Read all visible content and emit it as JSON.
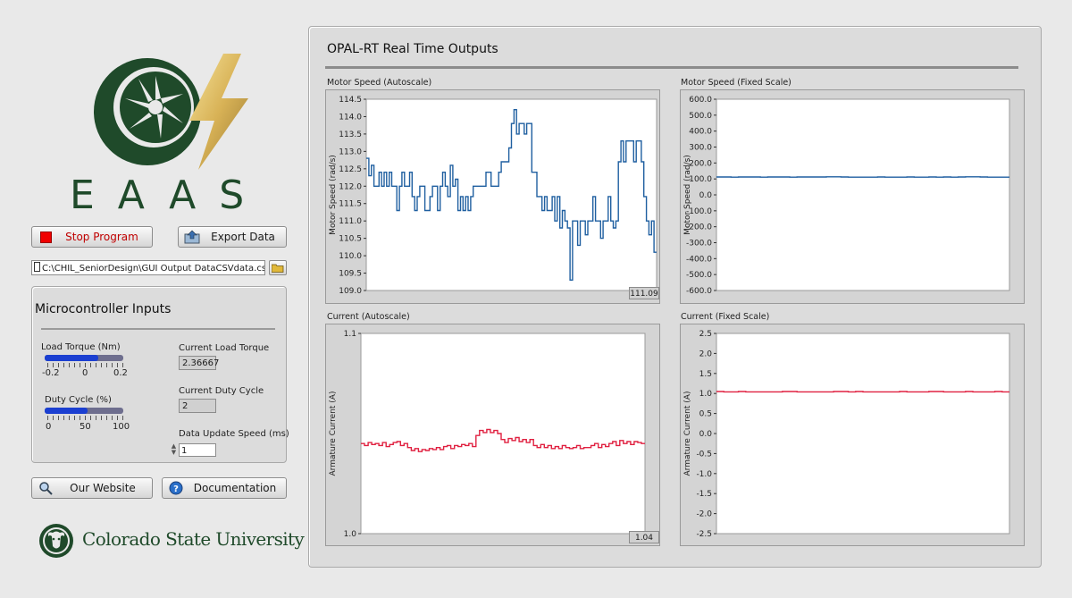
{
  "logo": {
    "text": "EAAS"
  },
  "buttons": {
    "stop": "Stop Program",
    "export": "Export Data",
    "website": "Our Website",
    "documentation": "Documentation"
  },
  "file_path": "C:\\CHIL_SeniorDesign\\GUI Output DataCSVdata.csv",
  "micro": {
    "title": "Microcontroller Inputs",
    "load_torque": {
      "label": "Load Torque (Nm)",
      "min_label": "-0.2",
      "mid_label": "0",
      "max_label": "0.2",
      "level": 0.68
    },
    "duty_cycle": {
      "label": "Duty Cycle (%)",
      "min_label": "0",
      "mid_label": "50",
      "max_label": "100",
      "level": 0.54
    },
    "current_load_torque": {
      "label": "Current Load Torque",
      "value": "2.36667"
    },
    "current_duty_cycle": {
      "label": "Current Duty Cycle",
      "value": "2"
    },
    "data_update_speed": {
      "label": "Data Update Speed (ms)",
      "value": "1"
    }
  },
  "university": "Colorado State University",
  "rt": {
    "title": "OPAL-RT Real Time Outputs"
  },
  "colors": {
    "speed": "#1f5fa0",
    "current": "#e02040"
  },
  "chart_data": [
    {
      "id": "speed_auto",
      "type": "line",
      "title": "Motor Speed (Autoscale)",
      "ylabel": "Motor Speed (rad/s)",
      "ylim": [
        109.0,
        114.5
      ],
      "yticks": [
        109.0,
        109.5,
        110.0,
        110.5,
        111.0,
        111.5,
        112.0,
        112.5,
        113.0,
        113.5,
        114.0,
        114.5
      ],
      "readout": "111.09",
      "color": "#1f5fa0",
      "values": [
        112.8,
        112.3,
        112.6,
        112.0,
        112.0,
        112.4,
        112.0,
        112.4,
        112.0,
        112.4,
        112.0,
        112.0,
        111.3,
        112.0,
        112.4,
        112.0,
        112.0,
        112.4,
        111.7,
        111.3,
        111.7,
        112.0,
        112.0,
        111.3,
        111.3,
        111.7,
        112.0,
        112.0,
        111.3,
        112.0,
        112.4,
        112.0,
        111.7,
        112.6,
        112.0,
        112.2,
        111.3,
        111.7,
        111.3,
        111.7,
        111.3,
        111.7,
        112.0,
        112.0,
        112.0,
        112.0,
        112.0,
        112.4,
        112.4,
        112.0,
        112.0,
        112.0,
        112.4,
        112.7,
        112.7,
        112.7,
        113.1,
        113.8,
        114.2,
        113.5,
        113.8,
        113.8,
        113.5,
        113.8,
        113.8,
        112.4,
        112.4,
        111.7,
        111.7,
        111.3,
        111.7,
        111.3,
        111.3,
        111.7,
        111.0,
        111.7,
        110.8,
        111.3,
        111.0,
        110.8,
        109.3,
        111.0,
        111.0,
        110.3,
        111.0,
        111.0,
        110.6,
        111.0,
        111.0,
        111.7,
        111.0,
        111.0,
        110.5,
        111.0,
        111.0,
        111.7,
        111.0,
        110.8,
        111.0,
        112.7,
        113.3,
        112.7,
        113.3,
        113.3,
        113.3,
        112.7,
        113.3,
        113.3,
        112.7,
        111.7,
        111.0,
        110.6,
        111.0,
        110.1
      ]
    },
    {
      "id": "speed_fixed",
      "type": "line",
      "title": "Motor Speed (Fixed Scale)",
      "ylabel": "Motor Speed (rad/s)",
      "ylim": [
        -600.0,
        600.0
      ],
      "yticks": [
        -600.0,
        -500.0,
        -400.0,
        -300.0,
        -200.0,
        -100.0,
        0.0,
        100.0,
        200.0,
        300.0,
        400.0,
        500.0,
        600.0
      ],
      "color": "#1f5fa0",
      "values": [
        112,
        112,
        111,
        112,
        112,
        112,
        111,
        112,
        112,
        112,
        111,
        112,
        112,
        112,
        112,
        113,
        113,
        112,
        111,
        111,
        111,
        111,
        112,
        111,
        111,
        111,
        112,
        111,
        111,
        112,
        111,
        112,
        111,
        112,
        113,
        113,
        112,
        111,
        111,
        111
      ]
    },
    {
      "id": "current_auto",
      "type": "line",
      "title": "Current (Autoscale)",
      "ylabel": "Armature Current (A)",
      "ylim": [
        1.0,
        1.1
      ],
      "yticks": [
        1.0,
        1.1
      ],
      "readout": "1.04",
      "color": "#e02040",
      "values": [
        1.045,
        1.044,
        1.0455,
        1.0445,
        1.045,
        1.044,
        1.0455,
        1.0435,
        1.0445,
        1.0455,
        1.046,
        1.044,
        1.045,
        1.043,
        1.0415,
        1.0425,
        1.041,
        1.042,
        1.0415,
        1.0425,
        1.042,
        1.043,
        1.042,
        1.0435,
        1.044,
        1.0425,
        1.044,
        1.0435,
        1.0445,
        1.044,
        1.045,
        1.0435,
        1.049,
        1.0515,
        1.0505,
        1.052,
        1.0505,
        1.0515,
        1.05,
        1.047,
        1.0455,
        1.0475,
        1.0465,
        1.048,
        1.046,
        1.047,
        1.0455,
        1.047,
        1.044,
        1.043,
        1.0445,
        1.043,
        1.044,
        1.0425,
        1.0435,
        1.0425,
        1.044,
        1.043,
        1.0425,
        1.043,
        1.044,
        1.0425,
        1.043,
        1.043,
        1.044,
        1.045,
        1.043,
        1.0445,
        1.0435,
        1.045,
        1.046,
        1.044,
        1.0465,
        1.045,
        1.046,
        1.0445,
        1.046,
        1.0455,
        1.045
      ]
    },
    {
      "id": "current_fixed",
      "type": "line",
      "title": "Current (Fixed Scale)",
      "ylabel": "Armature Current (A)",
      "ylim": [
        -2.5,
        2.5
      ],
      "yticks": [
        -2.5,
        -2.0,
        -1.5,
        -1.0,
        -0.5,
        0.0,
        0.5,
        1.0,
        1.5,
        2.0,
        2.5
      ],
      "color": "#e02040",
      "values": [
        1.05,
        1.04,
        1.04,
        1.05,
        1.04,
        1.04,
        1.04,
        1.04,
        1.04,
        1.05,
        1.05,
        1.04,
        1.04,
        1.04,
        1.04,
        1.04,
        1.05,
        1.05,
        1.04,
        1.05,
        1.04,
        1.04,
        1.04,
        1.04,
        1.04,
        1.05,
        1.04,
        1.04,
        1.04,
        1.05,
        1.05,
        1.04,
        1.04,
        1.04,
        1.05,
        1.04,
        1.04,
        1.04,
        1.05,
        1.04
      ]
    }
  ]
}
